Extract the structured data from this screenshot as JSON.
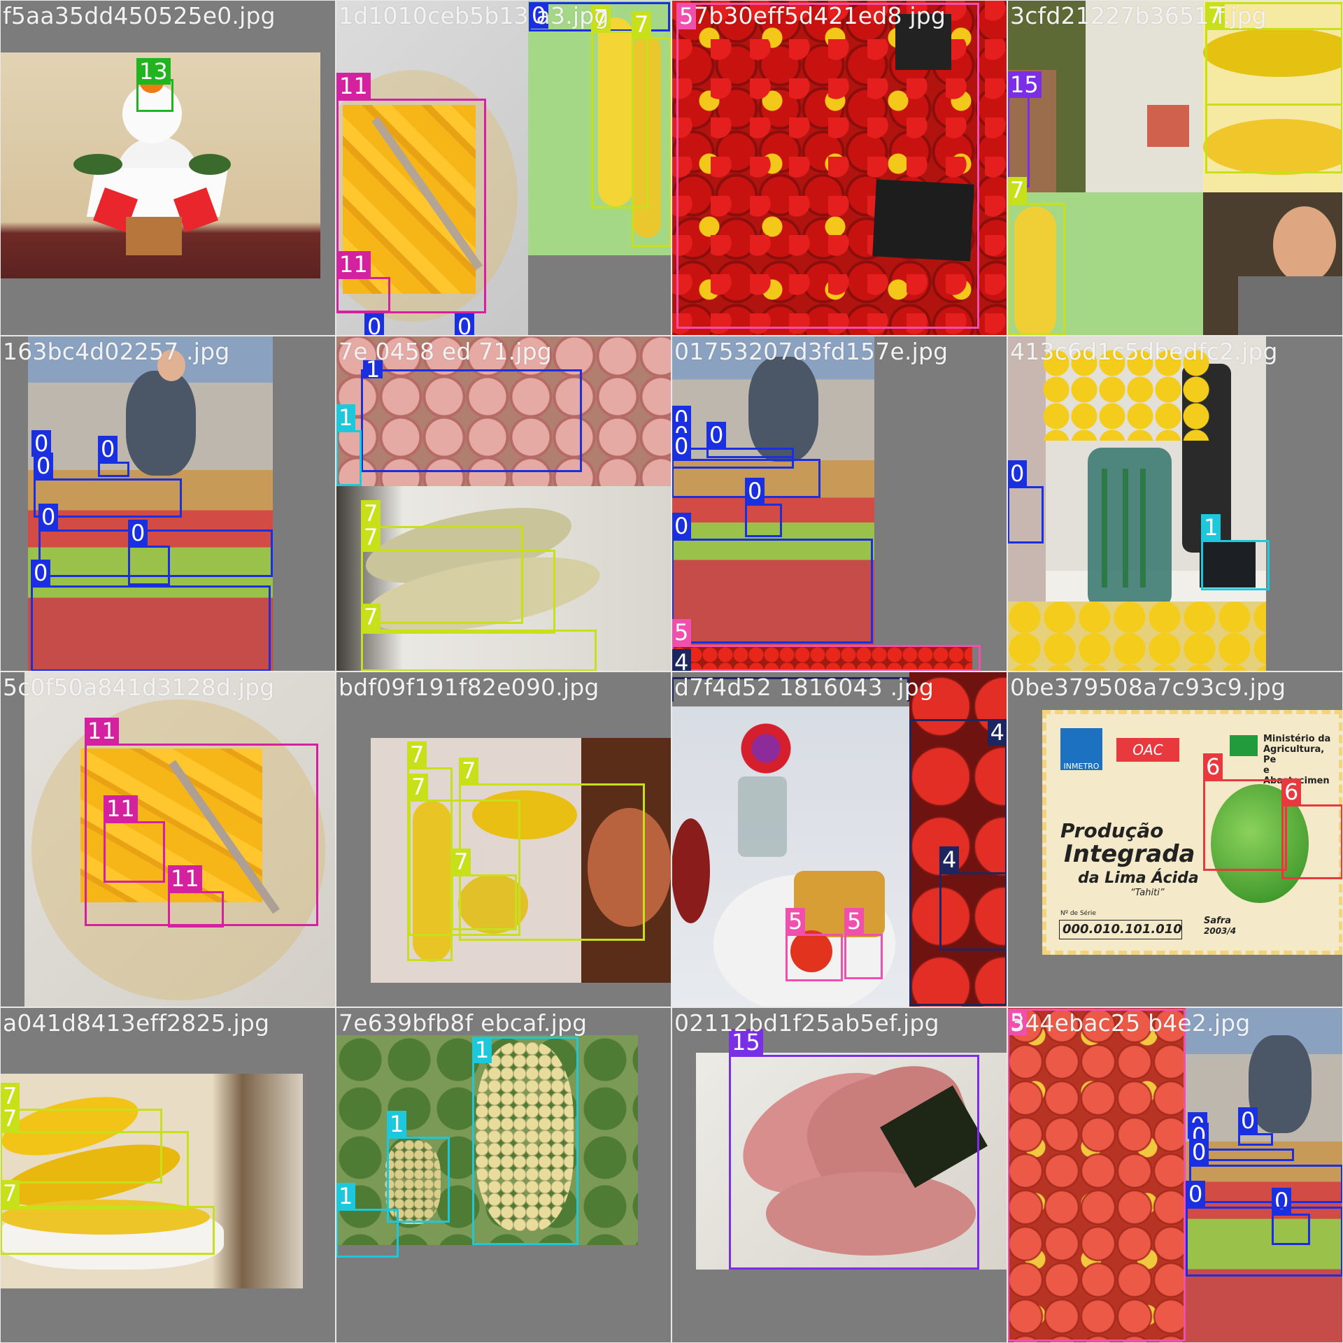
{
  "tiles": [
    {
      "filename": "f5aa35dd450525e0.jpg",
      "depicts": "new-year-decoration",
      "boxes": [
        {
          "label": "13",
          "color": "#22b41e"
        }
      ]
    },
    {
      "filename": "1d1010ceb5b13 a3.jpg",
      "depicts": "mango-and-bananas",
      "boxes": [
        {
          "label": "11",
          "color": "#d4219f"
        },
        {
          "label": "11",
          "color": "#d4219f"
        },
        {
          "label": "0",
          "color": "#1a2fe0"
        },
        {
          "label": "7",
          "color": "#c8e01a"
        },
        {
          "label": "7",
          "color": "#c8e01a"
        },
        {
          "label": "0",
          "color": "#1a2fe0"
        },
        {
          "label": "0",
          "color": "#1a2fe0"
        }
      ]
    },
    {
      "filename": "7b30eff5d421ed8 jpg",
      "depicts": "tomatoes",
      "boxes": [
        {
          "label": "5",
          "color": "#f04fae"
        }
      ]
    },
    {
      "filename": "3cfd21227b3651 f.jpg",
      "depicts": "bananas-and-person",
      "boxes": [
        {
          "label": "15",
          "color": "#7a2fe6"
        },
        {
          "label": "7",
          "color": "#c8e01a"
        },
        {
          "label": "7",
          "color": "#c8e01a"
        },
        {
          "label": "7",
          "color": "#c8e01a"
        }
      ]
    },
    {
      "filename": "163bc4d02257 .jpg",
      "depicts": "apple-market",
      "boxes": [
        {
          "label": "0",
          "color": "#1a2fe0"
        },
        {
          "label": "0",
          "color": "#1a2fe0"
        },
        {
          "label": "0",
          "color": "#1a2fe0"
        },
        {
          "label": "0",
          "color": "#1a2fe0"
        },
        {
          "label": "0",
          "color": "#1a2fe0"
        },
        {
          "label": "0",
          "color": "#1a2fe0"
        }
      ]
    },
    {
      "filename": "7e 0458 ed 71.jpg",
      "depicts": "apples-and-bananas",
      "boxes": [
        {
          "label": "1",
          "color": "#1ec8dc"
        },
        {
          "label": "7",
          "color": "#c8e01a"
        },
        {
          "label": "7",
          "color": "#c8e01a"
        },
        {
          "label": "7",
          "color": "#c8e01a"
        }
      ]
    },
    {
      "filename": "01753207d3fd157e.jpg",
      "depicts": "apple-market",
      "boxes": [
        {
          "label": "0",
          "color": "#1a2fe0"
        },
        {
          "label": "0",
          "color": "#1a2fe0"
        },
        {
          "label": "0",
          "color": "#1a2fe0"
        },
        {
          "label": "0",
          "color": "#1a2fe0"
        },
        {
          "label": "0",
          "color": "#1a2fe0"
        },
        {
          "label": "0",
          "color": "#1a2fe0"
        },
        {
          "label": "5",
          "color": "#f04fae"
        },
        {
          "label": "4",
          "color": "#1c2660"
        }
      ]
    },
    {
      "filename": "413c6d1c5dbedfc2.jpg",
      "depicts": "daffodils-vase",
      "boxes": [
        {
          "label": "0",
          "color": "#1a2fe0"
        },
        {
          "label": "1",
          "color": "#1ec8dc"
        }
      ]
    },
    {
      "filename": "5c0f50a841d3128d.jpg",
      "depicts": "mango-plate",
      "boxes": [
        {
          "label": "11",
          "color": "#d4219f"
        },
        {
          "label": "11",
          "color": "#d4219f"
        },
        {
          "label": "11",
          "color": "#d4219f"
        }
      ]
    },
    {
      "filename": "bdf09f191f82e090.jpg",
      "depicts": "bananas-box",
      "boxes": [
        {
          "label": "7",
          "color": "#c8e01a"
        },
        {
          "label": "7",
          "color": "#c8e01a"
        },
        {
          "label": "7",
          "color": "#c8e01a"
        },
        {
          "label": "7",
          "color": "#c8e01a"
        }
      ]
    },
    {
      "filename": "d7f4d52 1816043 .jpg",
      "depicts": "breakfast-strawberries",
      "boxes": [
        {
          "label": "4",
          "color": "#1c2660"
        },
        {
          "label": "4",
          "color": "#1c2660"
        },
        {
          "label": "5",
          "color": "#f04fae"
        },
        {
          "label": "5",
          "color": "#f04fae"
        }
      ]
    },
    {
      "filename": "0be379508a7c93c9.jpg",
      "depicts": "lime-certificate",
      "boxes": [
        {
          "label": "6",
          "color": "#e8393f"
        },
        {
          "label": "6",
          "color": "#e8393f"
        }
      ],
      "sticker": {
        "brand": "INMETRO",
        "badge": "OAC",
        "ministry": [
          "Ministério da",
          "Agricultura, Pe",
          "e Abastecimen"
        ],
        "title1": "Produção",
        "title2": "Integrada",
        "title3": "da Lima Ácida",
        "variety": "“Tahiti”",
        "serial_label": "Nº de Série",
        "serial": "000.010.101.010",
        "safra": "Safra",
        "safra_year": "2003/4"
      }
    },
    {
      "filename": "a041d8413eff2825.jpg",
      "depicts": "bananas-bowl",
      "boxes": [
        {
          "label": "7",
          "color": "#c8e01a"
        },
        {
          "label": "7",
          "color": "#c8e01a"
        },
        {
          "label": "7",
          "color": "#c8e01a"
        }
      ]
    },
    {
      "filename": "7e639bfb8f ebcaf.jpg",
      "depicts": "grapes-vine",
      "boxes": [
        {
          "label": "1",
          "color": "#1ec8dc"
        },
        {
          "label": "1",
          "color": "#1ec8dc"
        },
        {
          "label": "1",
          "color": "#1ec8dc"
        }
      ]
    },
    {
      "filename": "02112bd1f25ab5ef.jpg",
      "depicts": "watermelon-slices",
      "boxes": [
        {
          "label": "15",
          "color": "#7a2fe6"
        }
      ]
    },
    {
      "filename": "344ebac25 b4e2.jpg",
      "depicts": "tomatoes-and-apples",
      "boxes": [
        {
          "label": "5",
          "color": "#f04fae"
        },
        {
          "label": "0",
          "color": "#1a2fe0"
        },
        {
          "label": "0",
          "color": "#1a2fe0"
        },
        {
          "label": "0",
          "color": "#1a2fe0"
        },
        {
          "label": "0",
          "color": "#1a2fe0"
        },
        {
          "label": "0",
          "color": "#1a2fe0"
        },
        {
          "label": "0",
          "color": "#1a2fe0"
        }
      ]
    }
  ]
}
